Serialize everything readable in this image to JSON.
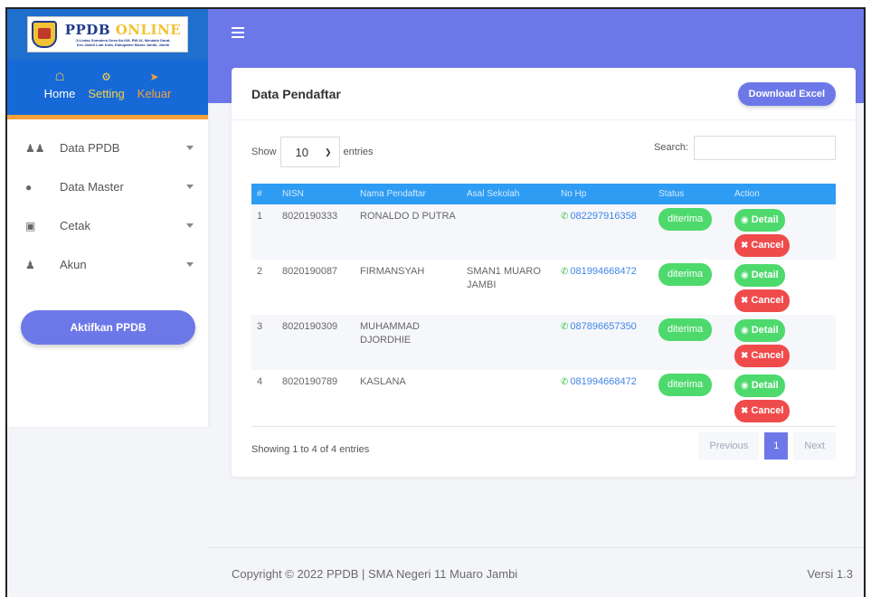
{
  "brand": {
    "title_part1": "PPDB",
    "title_part2": "ONLINE",
    "address_line1": "Jl.Lintas Sumatera Desa No.KM, RW.16, Mendalo Darat,",
    "address_line2": "Kec.Jambi Luar Kota, Kabupaten Muaro Jambi, Jambi"
  },
  "topnav": {
    "home": "Home",
    "setting": "Setting",
    "logout": "Keluar"
  },
  "sidebar": {
    "items": [
      {
        "label": "Data PPDB",
        "icon": "users-icon"
      },
      {
        "label": "Data Master",
        "icon": "database-icon"
      },
      {
        "label": "Cetak",
        "icon": "print-icon"
      },
      {
        "label": "Akun",
        "icon": "user-icon"
      }
    ],
    "activate_button": "Aktifkan PPDB"
  },
  "card": {
    "title": "Data Pendaftar",
    "download_button": "Download Excel",
    "show_label": "Show",
    "entries_value": "10",
    "entries_label": "entries",
    "search_label": "Search:",
    "search_value": ""
  },
  "table": {
    "columns": [
      "#",
      "NISN",
      "Nama Pendaftar",
      "Asal Sekolah",
      "No Hp",
      "Status",
      "Action"
    ],
    "rows": [
      {
        "no": "1",
        "nisn": "8020190333",
        "nama": "RONALDO D PUTRA",
        "asal": "",
        "hp": "082297916358",
        "status": "diterima"
      },
      {
        "no": "2",
        "nisn": "8020190087",
        "nama": "FIRMANSYAH",
        "asal": "SMAN1 MUARO JAMBI",
        "hp": "081994668472",
        "status": "diterima"
      },
      {
        "no": "3",
        "nisn": "8020190309",
        "nama": "MUHAMMAD DJORDHIE",
        "asal": "",
        "hp": "087896657350",
        "status": "diterima"
      },
      {
        "no": "4",
        "nisn": "8020190789",
        "nama": "KASLANA",
        "asal": "",
        "hp": "081994668472",
        "status": "diterima"
      }
    ],
    "detail_label": "Detail",
    "cancel_label": "Cancel"
  },
  "pagination": {
    "info": "Showing 1 to 4 of 4 entries",
    "previous": "Previous",
    "page": "1",
    "next": "Next"
  },
  "footer": {
    "copyright": "Copyright © 2022 PPDB | SMA Negeri 11 Muaro Jambi",
    "version": "Versi 1.3"
  },
  "colors": {
    "primary": "#6d78e8",
    "nav_blue": "#1769d8",
    "table_header": "#2e9cf3",
    "success": "#4ed96d",
    "danger": "#f04b4b",
    "accent_orange": "#f6a23b"
  }
}
